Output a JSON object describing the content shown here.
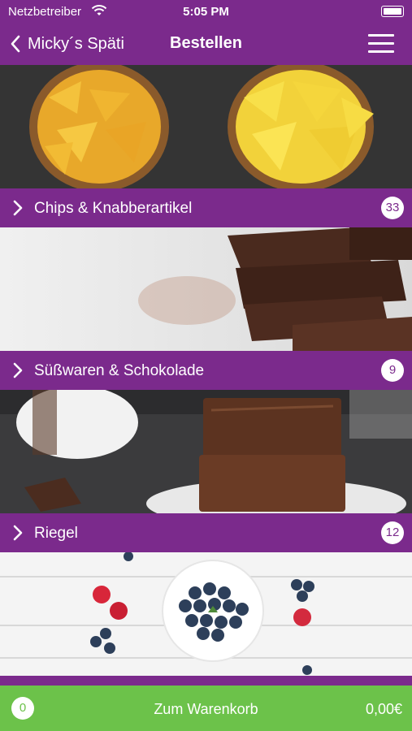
{
  "status_bar": {
    "carrier": "Netzbetreiber",
    "time": "5:05 PM"
  },
  "nav": {
    "back_label": "Micky´s Späti",
    "title": "Bestellen"
  },
  "categories": [
    {
      "label": "Chips & Knabberartikel",
      "count": "33",
      "image": "chips-photo"
    },
    {
      "label": "Süßwaren & Schokolade",
      "count": "9",
      "image": "chocolate-photo"
    },
    {
      "label": "Riegel",
      "count": "12",
      "image": "brownie-photo"
    },
    {
      "label": "",
      "count": "",
      "image": "blueberries-photo"
    }
  ],
  "cart": {
    "count": "0",
    "label": "Zum Warenkorb",
    "total": "0,00€"
  },
  "colors": {
    "primary": "#7b2a8c",
    "cart_green": "#6cc24a"
  }
}
